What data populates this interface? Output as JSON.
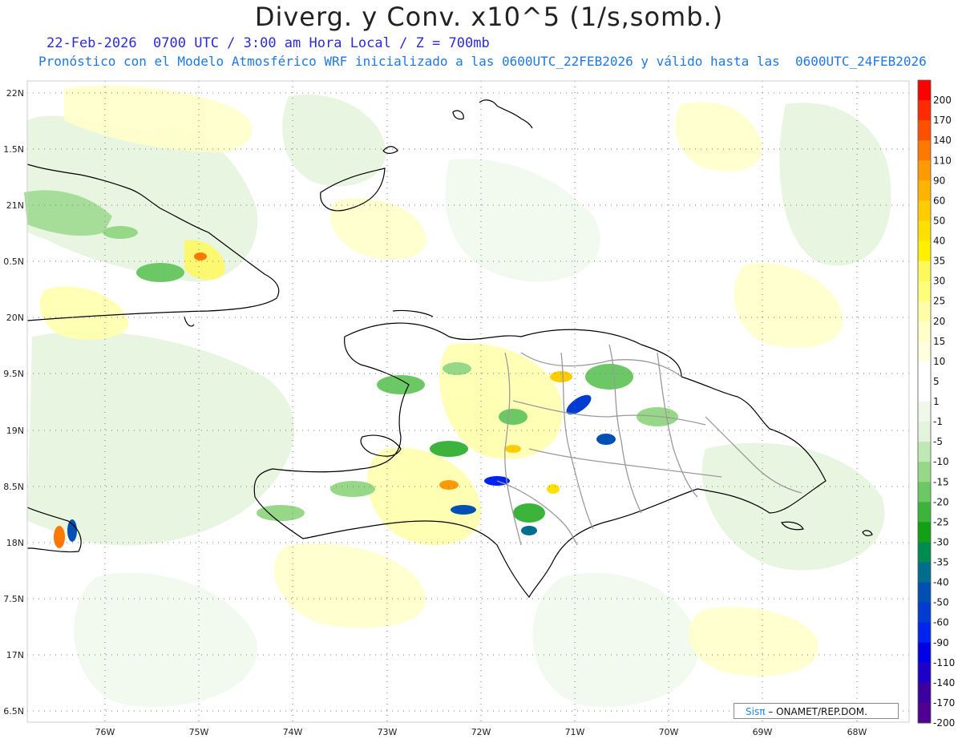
{
  "header": {
    "title": "Diverg. y Conv. x10^5 (1/s,somb.)",
    "line1": "22-Feb-2026  0700 UTC / 3:00 am Hora Local / Z = 700mb",
    "line2": "Pronóstico con el Modelo Atmosférico WRF inicializado a las 0600UTC_22FEB2026 y válido hasta las  0600UTC_24FEB2026"
  },
  "map": {
    "lat_labels": [
      "22N",
      "1.5N",
      "21N",
      "0.5N",
      "20N",
      "9.5N",
      "19N",
      "8.5N",
      "18N",
      "7.5N",
      "17N",
      "6.5N"
    ],
    "lon_labels": [
      "76W",
      "75W",
      "74W",
      "73W",
      "72W",
      "71W",
      "70W",
      "69W",
      "68W"
    ]
  },
  "colorbar": {
    "labels": [
      "200",
      "170",
      "140",
      "110",
      "90",
      "60",
      "50",
      "40",
      "35",
      "30",
      "25",
      "20",
      "15",
      "10",
      "5",
      "1",
      "-1",
      "-5",
      "-10",
      "-15",
      "-20",
      "-25",
      "-30",
      "-35",
      "-40",
      "-50",
      "-60",
      "-90",
      "-110",
      "-140",
      "-170",
      "-200"
    ],
    "colors": [
      "#ff0000",
      "#ff2a00",
      "#ff5000",
      "#ff7800",
      "#ff9a00",
      "#ffb400",
      "#ffcc00",
      "#ffe000",
      "#fff000",
      "#fff85a",
      "#ffff7a",
      "#ffffa8",
      "#ffffc8",
      "#ffffe0",
      "#ffffff",
      "#ffffff",
      "#f0f8ec",
      "#e4f4dc",
      "#c0e8b4",
      "#96d888",
      "#6cc864",
      "#3cb43c",
      "#14a014",
      "#008c50",
      "#006e8c",
      "#0050b4",
      "#003cd2",
      "#0024f0",
      "#0000e6",
      "#1e00c8",
      "#3c00a0",
      "#500090"
    ]
  },
  "credit": {
    "logo_text": "Sisπ",
    "text": "– ONAMET/REP.DOM."
  }
}
